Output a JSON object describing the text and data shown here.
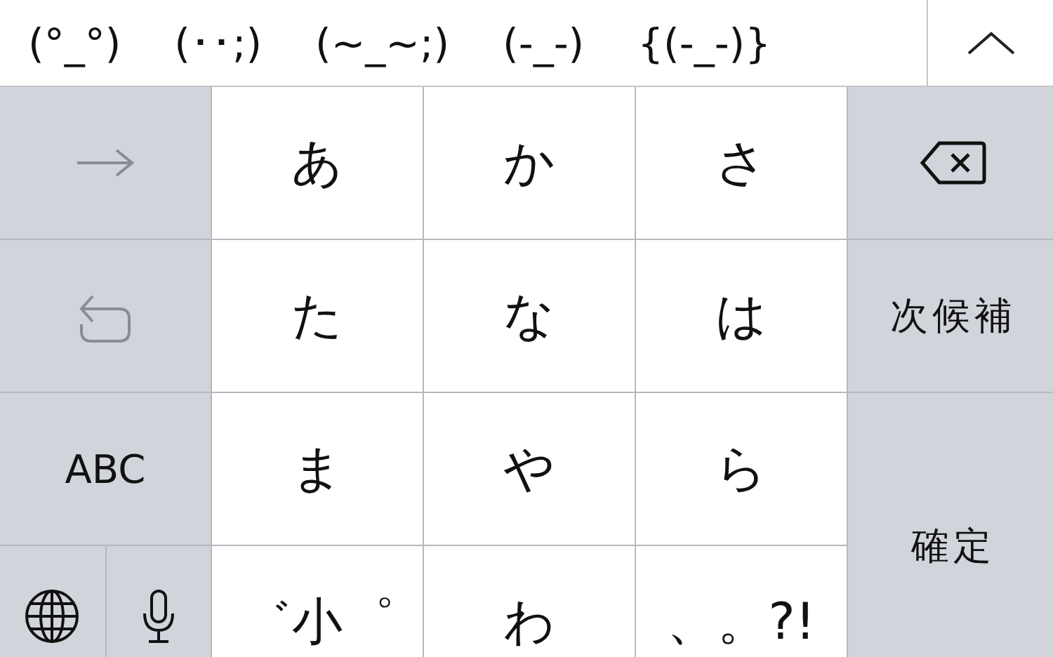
{
  "candidates": [
    "(°_°)",
    "(･･;)",
    "(~_~;)",
    "(-_-)",
    "{(-_-)}"
  ],
  "left_keys": [
    {
      "kind": "arrow",
      "disabled": true
    },
    {
      "kind": "undo",
      "disabled": true
    },
    {
      "kind": "text",
      "label": "ABC",
      "disabled": false
    }
  ],
  "kana_keys": [
    "あ",
    "か",
    "さ",
    "た",
    "な",
    "は",
    "ま",
    "や",
    "ら",
    "゛小゜",
    "わ",
    "、。?!"
  ],
  "next_candidate": "次候補",
  "confirm": "確定"
}
